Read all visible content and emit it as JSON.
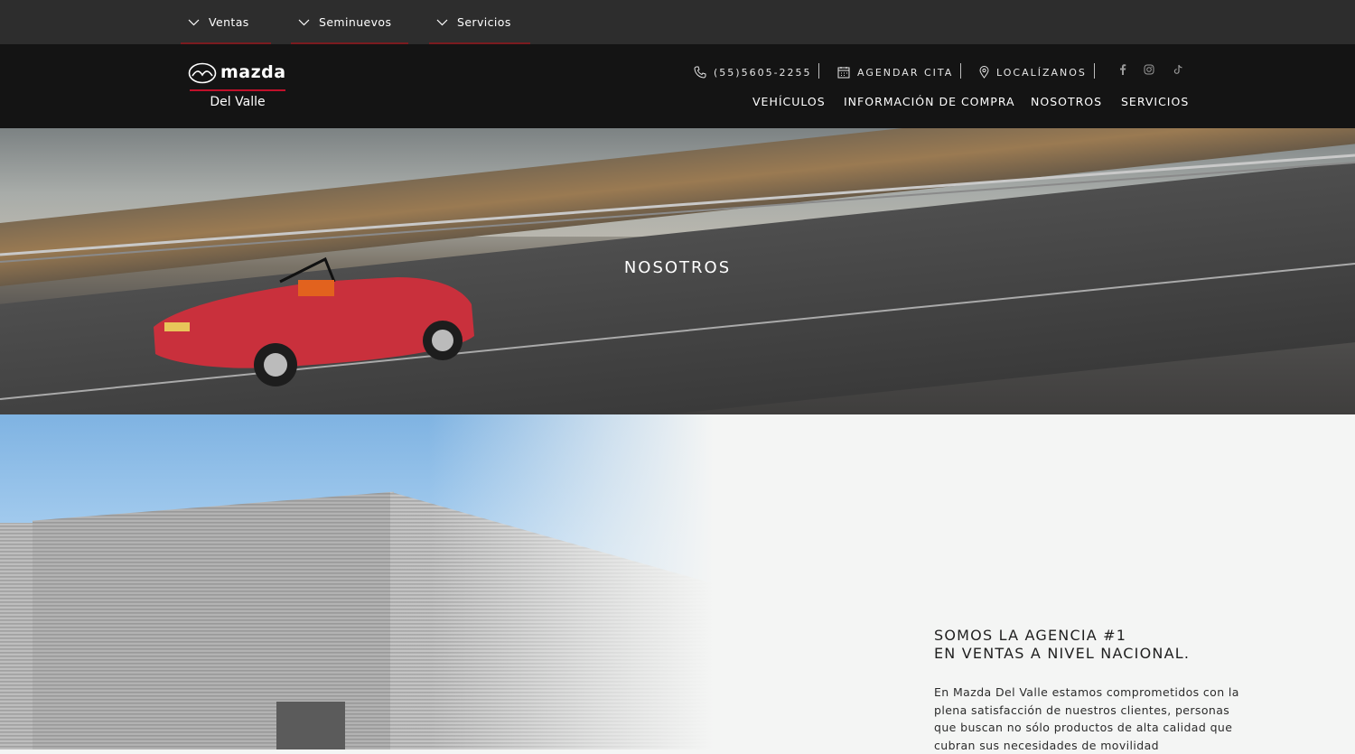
{
  "topbar": {
    "tabs": [
      {
        "label": "Ventas"
      },
      {
        "label": "Seminuevos"
      },
      {
        "label": "Servicios"
      }
    ]
  },
  "header": {
    "logo_word": "mazda",
    "logo_sub": "Del Valle",
    "phone": "(55)5605-2255",
    "appointment": "AGENDAR CITA",
    "locate": "LOCALÍZANOS",
    "social": [
      "facebook-icon",
      "instagram-icon",
      "tiktok-icon"
    ],
    "nav": [
      "VEHÍCULOS",
      "INFORMACIÓN DE COMPRA",
      "NOSOTROS",
      "SERVICIOS"
    ]
  },
  "hero": {
    "title": "NOSOTROS"
  },
  "about": {
    "heading_line1": "SOMOS LA AGENCIA #1",
    "heading_line2": "EN VENTAS A NIVEL NACIONAL.",
    "paragraph": "En Mazda Del Valle estamos comprometidos con la plena satisfacción de nuestros clientes, personas que buscan no sólo productos de alta calidad que cubran sus necesidades de movilidad"
  },
  "colors": {
    "accent": "#c0102a",
    "header_bg": "#141414",
    "topbar_bg": "#2d2d2d"
  }
}
